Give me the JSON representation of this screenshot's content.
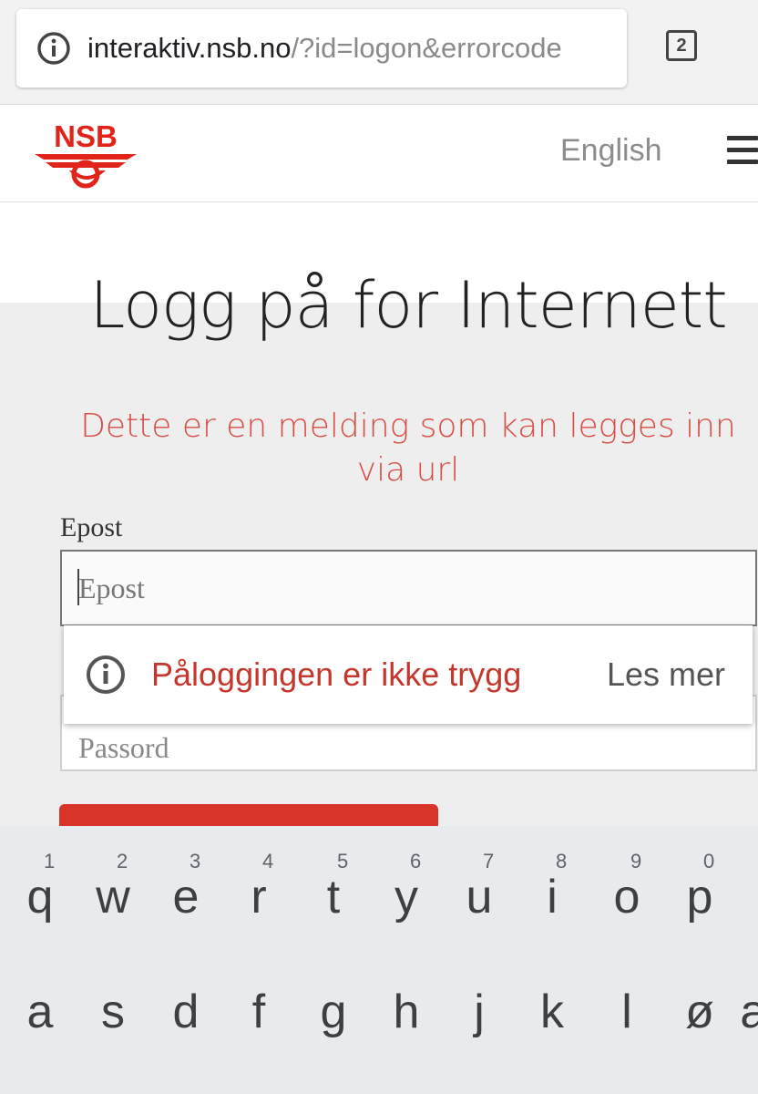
{
  "browser": {
    "url_domain": "interaktiv.nsb.no",
    "url_path": "/?id=logon&errorcode",
    "tab_count": "2"
  },
  "header": {
    "logo_text": "NSB",
    "language_link": "English"
  },
  "main": {
    "title": "Logg på for Internett",
    "error_message": "Dette er en melding som kan legges inn via url",
    "email_label": "Epost",
    "email_placeholder": "Epost",
    "password_placeholder": "Passord"
  },
  "security_popup": {
    "message": "Påloggingen er ikke trygg",
    "link": "Les mer"
  },
  "keyboard": {
    "row1": [
      {
        "letter": "q",
        "hint": "1"
      },
      {
        "letter": "w",
        "hint": "2"
      },
      {
        "letter": "e",
        "hint": "3"
      },
      {
        "letter": "r",
        "hint": "4"
      },
      {
        "letter": "t",
        "hint": "5"
      },
      {
        "letter": "y",
        "hint": "6"
      },
      {
        "letter": "u",
        "hint": "7"
      },
      {
        "letter": "i",
        "hint": "8"
      },
      {
        "letter": "o",
        "hint": "9"
      },
      {
        "letter": "p",
        "hint": "0"
      }
    ],
    "row2": [
      {
        "letter": "a"
      },
      {
        "letter": "s"
      },
      {
        "letter": "d"
      },
      {
        "letter": "f"
      },
      {
        "letter": "g"
      },
      {
        "letter": "h"
      },
      {
        "letter": "j"
      },
      {
        "letter": "k"
      },
      {
        "letter": "l"
      },
      {
        "letter": "ø"
      },
      {
        "letter": "æ"
      }
    ]
  },
  "colors": {
    "brand_red": "#d9342a",
    "error_text": "#d94c43",
    "popup_warning": "#c5372c"
  },
  "icons": {
    "url_info": "info-icon",
    "popup_info": "info-icon",
    "menu": "hamburger-menu-icon",
    "logo": "nsb-logo"
  }
}
